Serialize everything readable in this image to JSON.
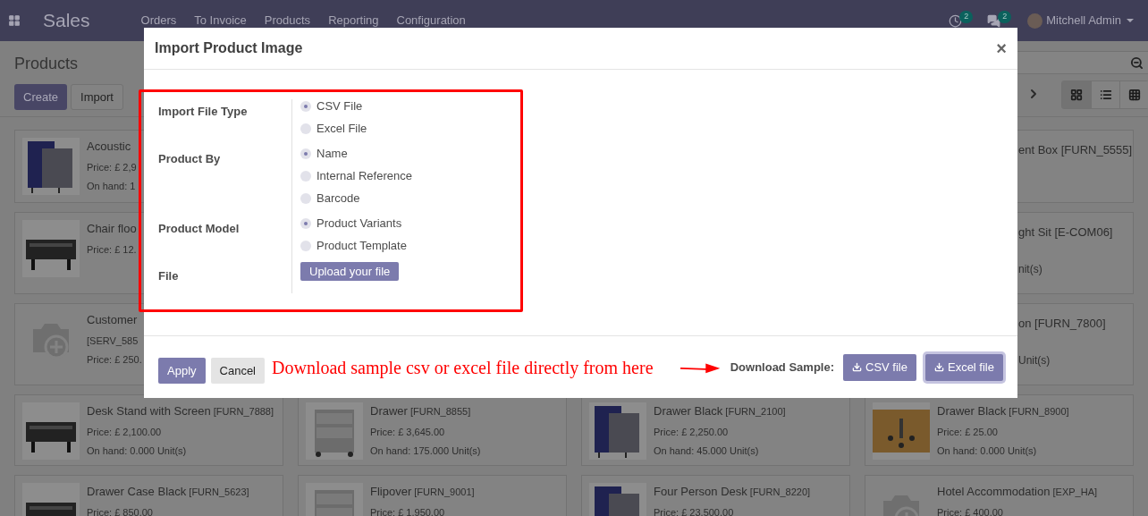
{
  "navbar": {
    "app": "Sales",
    "menu": [
      "Orders",
      "To Invoice",
      "Products",
      "Reporting",
      "Configuration"
    ],
    "activity_count": "2",
    "message_count": "2",
    "user": "Mitchell Admin"
  },
  "control_panel": {
    "title": "Products",
    "buttons": [
      {
        "label": "Create",
        "kind": "primary"
      },
      {
        "label": "Import",
        "kind": "secondary"
      }
    ],
    "views": [
      {
        "kind": "kanban",
        "selected": true
      },
      {
        "kind": "list",
        "selected": false
      },
      {
        "kind": "grid",
        "selected": false
      }
    ]
  },
  "kanban": [
    {
      "kind": "left",
      "name": "Acoustic",
      "lines": [
        "Price: £ 2,9",
        "On hand: 1"
      ]
    },
    {
      "kind": "right",
      "name": "ent Box [FURN_5555]"
    },
    {
      "kind": "left",
      "name": "Chair floo",
      "lines": [
        "Price: £ 12."
      ]
    },
    {
      "kind": "right",
      "name": "ght Sit [E-COM06]",
      "lines": [
        "nit(s)"
      ]
    },
    {
      "kind": "left",
      "name": "Customer",
      "lines": [
        "[SERV_585",
        "Price: £ 250."
      ]
    },
    {
      "kind": "right",
      "name": "on [FURN_7800]",
      "lines": [
        "Unit(s)"
      ]
    },
    {
      "kind": "full",
      "name": "Desk Stand with Screen",
      "ref": "[FURN_7888]",
      "lines": [
        "Price: £ 2,100.00",
        "On hand: 0.000 Unit(s)"
      ]
    },
    {
      "kind": "full",
      "name": "Drawer",
      "ref": "[FURN_8855]",
      "lines": [
        "Price: £ 3,645.00",
        "On hand: 175.000 Unit(s)"
      ]
    },
    {
      "kind": "full",
      "name": "Drawer Black",
      "ref": "[FURN_2100]",
      "lines": [
        "Price: £ 2,250.00",
        "On hand: 45.000 Unit(s)"
      ]
    },
    {
      "kind": "full",
      "name": "Drawer Black",
      "ref": "[FURN_8900]",
      "lines": [
        "Price: £ 25.00",
        "On hand: 0.000 Unit(s)"
      ]
    },
    {
      "kind": "full",
      "name": "Drawer Case Black",
      "ref": "[FURN_5623]",
      "lines": [
        "Price: £ 850.00"
      ]
    },
    {
      "kind": "full",
      "name": "Flipover",
      "ref": "[FURN_9001]",
      "lines": [
        "Price: £ 1,950.00"
      ]
    },
    {
      "kind": "full",
      "name": "Four Person Desk",
      "ref": "[FURN_8220]",
      "lines": [
        "Price: £ 23,500.00"
      ]
    },
    {
      "kind": "full",
      "name": "Hotel Accommodation",
      "ref": "[EXP_HA]",
      "lines": [
        "Price: £ 400.00"
      ]
    }
  ],
  "modal": {
    "title": "Import Product Image",
    "close": "×",
    "fields": [
      {
        "label": "Import File Type",
        "kind": "radio",
        "options": [
          {
            "label": "CSV File",
            "selected": true
          },
          {
            "label": "Excel File",
            "selected": false
          }
        ]
      },
      {
        "label": "Product By",
        "kind": "radio",
        "options": [
          {
            "label": "Name",
            "selected": true
          },
          {
            "label": "Internal Reference",
            "selected": false
          },
          {
            "label": "Barcode",
            "selected": false
          }
        ]
      },
      {
        "label": "Product Model",
        "kind": "radio",
        "options": [
          {
            "label": "Product Variants",
            "selected": true
          },
          {
            "label": "Product Template",
            "selected": false
          }
        ]
      },
      {
        "label": "File",
        "kind": "upload",
        "button": "Upload your file"
      }
    ],
    "actions": [
      {
        "label": "Apply",
        "kind": "primary"
      },
      {
        "label": "Cancel",
        "kind": "secondary"
      }
    ],
    "annotation": "Download sample csv or excel file directly from here",
    "download_label": "Download Sample:",
    "downloads": [
      {
        "label": "CSV file",
        "focused": false
      },
      {
        "label": "Excel file",
        "focused": true
      }
    ]
  }
}
